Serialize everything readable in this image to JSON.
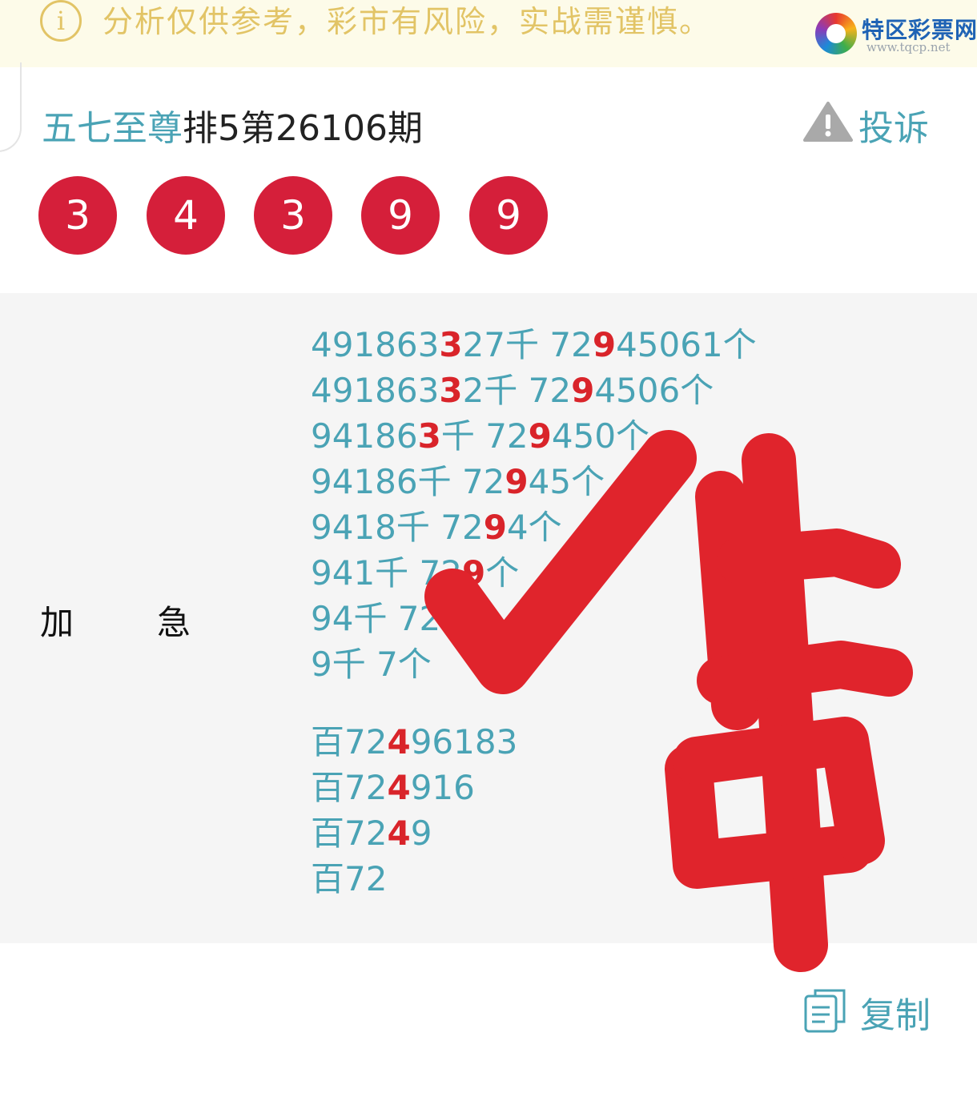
{
  "notice": {
    "icon": "info-icon",
    "icon_glyph": "i",
    "text": "分析仅供参考，彩市有风险，实战需谨慎。"
  },
  "brand": {
    "name": "特区彩票网",
    "url": "www.tqcp.net"
  },
  "header": {
    "author": "五七至尊",
    "title_rest": "排5第26106期",
    "complain_label": "投诉",
    "complain_icon": "warning-icon"
  },
  "balls": [
    "3",
    "4",
    "3",
    "9",
    "9"
  ],
  "content": {
    "label_left": "加",
    "label_right": "急",
    "qian_ge_lines": [
      [
        {
          "t": "491863"
        },
        {
          "t": "3",
          "hot": true
        },
        {
          "t": "27千 72"
        },
        {
          "t": "9",
          "hot": true
        },
        {
          "t": "45061个"
        }
      ],
      [
        {
          "t": "491863"
        },
        {
          "t": "3",
          "hot": true
        },
        {
          "t": "2千 72"
        },
        {
          "t": "9",
          "hot": true
        },
        {
          "t": "4506个"
        }
      ],
      [
        {
          "t": "94186"
        },
        {
          "t": "3",
          "hot": true
        },
        {
          "t": "千 72"
        },
        {
          "t": "9",
          "hot": true
        },
        {
          "t": "450个"
        }
      ],
      [
        {
          "t": "94186千 72"
        },
        {
          "t": "9",
          "hot": true
        },
        {
          "t": "45个"
        }
      ],
      [
        {
          "t": "9418千 72"
        },
        {
          "t": "9",
          "hot": true
        },
        {
          "t": "4个"
        }
      ],
      [
        {
          "t": "941千 72"
        },
        {
          "t": "9",
          "hot": true
        },
        {
          "t": "个"
        }
      ],
      [
        {
          "t": "94千 72"
        }
      ],
      [
        {
          "t": "9千 7个"
        }
      ]
    ],
    "bai_lines": [
      [
        {
          "t": "百72"
        },
        {
          "t": "4",
          "hot": true
        },
        {
          "t": "96183"
        }
      ],
      [
        {
          "t": "百72"
        },
        {
          "t": "4",
          "hot": true
        },
        {
          "t": "916"
        }
      ],
      [
        {
          "t": "百72"
        },
        {
          "t": "4",
          "hot": true
        },
        {
          "t": "9"
        }
      ],
      [
        {
          "t": "百72"
        }
      ]
    ]
  },
  "stamp": {
    "icons": [
      "checkmark-icon",
      "zhong-character-mark"
    ],
    "color": "#e0242c"
  },
  "footer": {
    "copy_label": "复制",
    "copy_icon": "copy-icon"
  },
  "colors": {
    "accent": "#4aa3b5",
    "ball": "#d51f3a",
    "hot": "#d9242a",
    "notice_text": "#e2c466",
    "notice_bg": "#fdfbe9",
    "panel_bg": "#f5f5f5"
  }
}
